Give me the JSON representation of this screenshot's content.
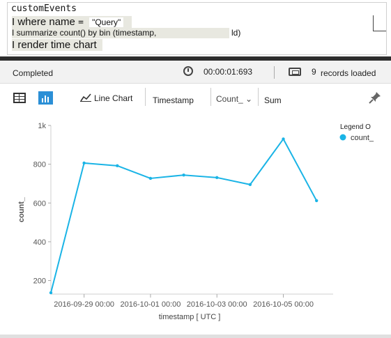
{
  "editor": {
    "line0": "customEvents",
    "line1_kw": "I where name",
    "line1_op": "=",
    "line1_val": "\"Query\"",
    "line2": "I summarize count() by bin (timestamp,",
    "line2_tail": "ld)",
    "line3": "I render time chart"
  },
  "status": {
    "state": "Completed",
    "elapsed": "00:00:01:693",
    "record_count": "9",
    "records_label": "records loaded"
  },
  "toolbar": {
    "table_icon": "table-icon",
    "chart_icon": "bar-chart-icon",
    "chart_type": "Line Chart",
    "x_field": "Timestamp",
    "y_field": "Count_",
    "aggregation": "Sum",
    "pin_icon": "pin-icon"
  },
  "colors": {
    "series": "#1ab4e6",
    "accent": "#2b8fd6"
  },
  "chart_data": {
    "type": "line",
    "xlabel": "timestamp [ UTC ]",
    "ylabel": "count_",
    "ylim": [
      130,
      1000
    ],
    "xlim": [
      "2016-09-28 00:00",
      "2016-10-06 12:00"
    ],
    "yticks": [
      200,
      400,
      600,
      800,
      1000
    ],
    "ytick_labels": [
      "200",
      "400",
      "600",
      "800",
      "1k"
    ],
    "xtick_labels": [
      "2016-09-29 00:00",
      "2016-10-01 00:00",
      "2016-10-03 00:00",
      "2016-10-05 00:00"
    ],
    "legend": {
      "title": "Legend O",
      "position": "top-right"
    },
    "series": [
      {
        "name": "count_",
        "x": [
          "2016-09-28 00:00",
          "2016-09-29 00:00",
          "2016-09-30 00:00",
          "2016-10-01 00:00",
          "2016-10-02 00:00",
          "2016-10-03 00:00",
          "2016-10-04 00:00",
          "2016-10-05 00:00",
          "2016-10-06 00:00"
        ],
        "values": [
          137,
          806,
          792,
          727,
          744,
          731,
          695,
          930,
          612
        ]
      }
    ]
  }
}
